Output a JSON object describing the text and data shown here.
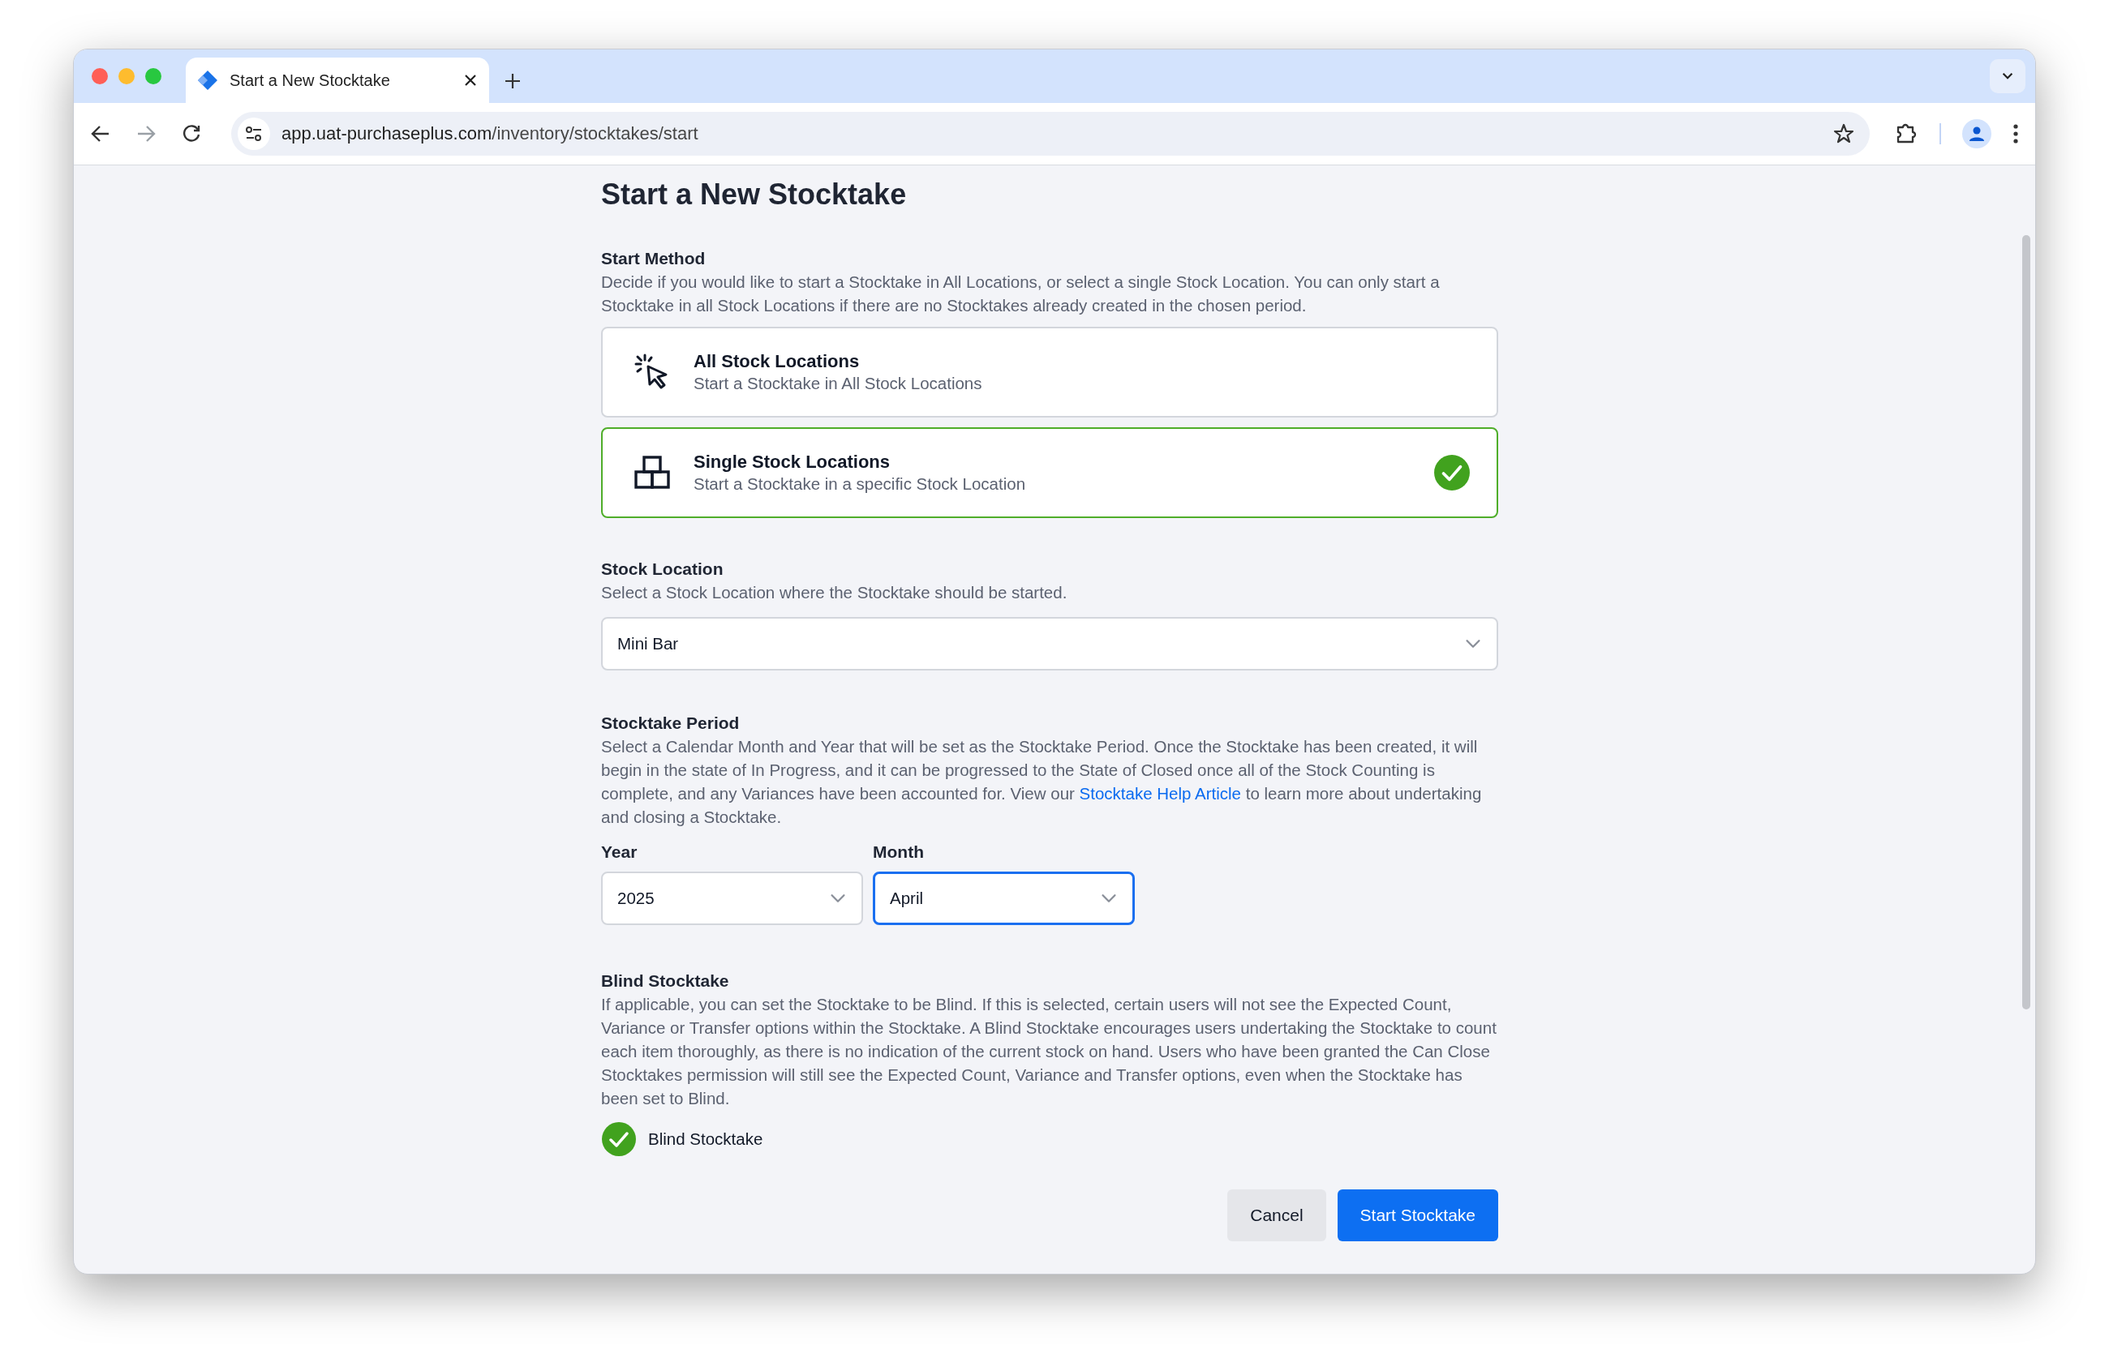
{
  "browser": {
    "tabs": [
      {
        "title": "Start a New Stocktake",
        "selected": true
      }
    ],
    "address": {
      "host": "app.uat-purchaseplus.com",
      "path": "/inventory/stocktakes/start"
    }
  },
  "page": {
    "title": "Start a New Stocktake",
    "start_method": {
      "heading": "Start Method",
      "description": "Decide if you would like to start a Stocktake in All Locations, or select a single Stock Location. You can only start a Stocktake in all Stock Locations if there are no Stocktakes already created in the chosen period.",
      "options": [
        {
          "kind": "cursor",
          "title": "All Stock Locations",
          "subtitle": "Start a Stocktake in All Stock Locations",
          "selected": false
        },
        {
          "kind": "blocks",
          "title": "Single Stock Locations",
          "subtitle": "Start a Stocktake in a specific Stock Location",
          "selected": true
        }
      ]
    },
    "stock_location": {
      "heading": "Stock Location",
      "description": "Select a Stock Location where the Stocktake should be started.",
      "value": "Mini Bar"
    },
    "period": {
      "heading": "Stocktake Period",
      "description_before": "Select a Calendar Month and Year that will be set as the Stocktake Period. Once the Stocktake has been created, it will begin in the state of In Progress, and it can be progressed to the State of Closed once all of the Stock Counting is complete, and any Variances have been accounted for. View our ",
      "link": "Stocktake Help Article",
      "description_after": " to learn more about undertaking and closing a Stocktake.",
      "fields": [
        {
          "label": "Year",
          "value": "2025",
          "focused": false
        },
        {
          "label": "Month",
          "value": "April",
          "focused": true
        }
      ]
    },
    "blind": {
      "heading": "Blind Stocktake",
      "description": "If applicable, you can set the Stocktake to be Blind. If this is selected, certain users will not see the Expected Count, Variance or Transfer options within the Stocktake. A Blind Stocktake encourages users undertaking the Stocktake to count each item thoroughly, as there is no indication of the current stock on hand. Users who have been granted the Can Close Stocktakes permission will still see the Expected Count, Variance and Transfer options, even when the Stocktake has been set to Blind.",
      "checkbox": {
        "label": "Blind Stocktake",
        "checked": true
      }
    },
    "buttons": [
      {
        "kind": "secondary",
        "label": "Cancel"
      },
      {
        "kind": "primary",
        "label": "Start Stocktake"
      }
    ]
  }
}
